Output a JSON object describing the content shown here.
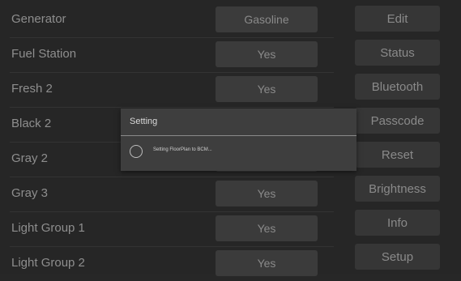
{
  "rows": [
    {
      "label": "Generator",
      "value": "Gasoline"
    },
    {
      "label": "Fuel Station",
      "value": "Yes"
    },
    {
      "label": "Fresh 2",
      "value": "Yes"
    },
    {
      "label": "Black 2",
      "value": ""
    },
    {
      "label": "Gray 2",
      "value": ""
    },
    {
      "label": "Gray 3",
      "value": "Yes"
    },
    {
      "label": "Light Group 1",
      "value": "Yes"
    },
    {
      "label": "Light Group 2",
      "value": "Yes"
    }
  ],
  "side_buttons": [
    "Edit",
    "Status",
    "Bluetooth",
    "Passcode",
    "Reset",
    "Brightness",
    "Info",
    "Setup"
  ],
  "modal": {
    "title": "Setting",
    "message": "Setting FloorPlan to BCM..."
  },
  "colors": {
    "background": "#262626",
    "button": "#363636",
    "text": "#8a8a8a"
  },
  "icons": {
    "spinner": "loading-spinner-icon"
  }
}
